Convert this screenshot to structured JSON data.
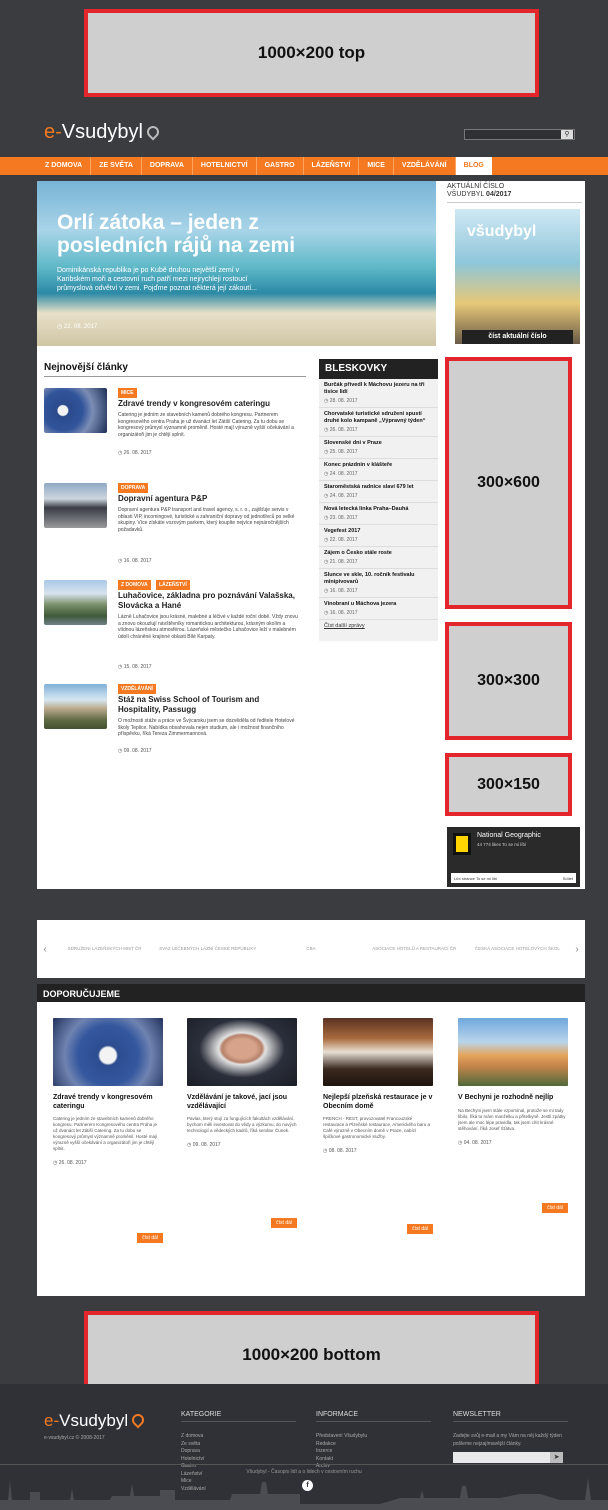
{
  "ads": {
    "top": "1000×200 top",
    "side1": "300×600",
    "side2": "300×300",
    "side3": "300×150",
    "bottom": "1000×200 bottom"
  },
  "header": {
    "logo_e": "e-",
    "logo_rest": "Vsudybyl",
    "search_placeholder": "",
    "search_icon": "search-icon"
  },
  "nav": [
    "Z DOMOVA",
    "ZE SVĚTA",
    "DOPRAVA",
    "HOTELNICTVÍ",
    "GASTRO",
    "LÁZEŇSTVÍ",
    "MICE",
    "VZDĚLÁVÁNÍ",
    "BLOG"
  ],
  "hero": {
    "title": "Orlí zátoka – jeden z posledních rájů na zemi",
    "text": "Dominikánská republika je po Kubě druhou největší zemí v Karibském moři a cestovní ruch patří mezi nejrychleji rostoucí průmyslová odvětví v zemi. Pojďme poznat některá její zákoutí...",
    "date": "22. 08. 2017"
  },
  "latest": {
    "heading": "Nejnovější články",
    "items": [
      {
        "tags": [
          "MICE"
        ],
        "title": "Zdravé trendy v kongresovém cateringu",
        "text": "Catering je jedním ze stavebních kamenů dobrého kongresu. Partnerem kongresového centra Praha je už dvanáct let Zátiší Catering. Za tu dobu se kongresový průmysl významně proměnil. Hosté mají výrazně vyšší očekávání a organizátoři jim je chtějí splnit.",
        "date": "26. 08. 2017"
      },
      {
        "tags": [
          "DOPRAVA"
        ],
        "title": "Dopravní agentura P&P",
        "text": "Dopravní agentura P&P transport and travel agency, s. r. o., zajišťuje servis v oblasti VIP, incomingové, turistické a zahraniční dopravy od jednotlivců po velké skupiny. Více získáte vozovým parkem, který koupíte nejvíce nejnáročnějších požadavků.",
        "date": "16. 08. 2017"
      },
      {
        "tags": [
          "Z DOMOVA",
          "LÁZEŇSTVÍ"
        ],
        "title": "Luhačovice, základna pro poznávání Valašska, Slovácka a Hané",
        "text": "Lázně Luhačovice jsou krásné, malebné a léčivé v každé roční době. Vždy znovu a znovu okouzlují návštěvníky romantickou architekturou, krásným okolím a vlídnou lázeňskou atmosférou. Lázeňské městečko Luhačovice leží v malebném údolí chráněné krajinné oblasti Bílé Karpaty.",
        "date": "15. 08. 2017"
      },
      {
        "tags": [
          "VZDĚLÁVÁNÍ"
        ],
        "title": "Stáž na Swiss School of Tourism and Hospitality, Passugg",
        "text": "O možnosti stáže a práce ve Švýcarsku jsem se dozvěděla od ředitele Hotelové školy Teplice. Nabídka obsahovala nejen studium, ale i možnost finančního příspěvku, říká Tereza Zimmermannová.",
        "date": "09. 08. 2017"
      }
    ]
  },
  "bleskovky": {
    "heading": "BLESKOVKY",
    "items": [
      {
        "title": "Burčák přivedl k Máchovu jezeru na tři tisíce lidí",
        "date": "28. 08. 2017"
      },
      {
        "title": "Chorvatské turistické sdružení spustí druhé kolo kampaně „Výpravný týden“",
        "date": "26. 08. 2017"
      },
      {
        "title": "Slovenské dni v Praze",
        "date": "25. 08. 2017"
      },
      {
        "title": "Konec prázdnin v klášteře",
        "date": "24. 08. 2017"
      },
      {
        "title": "Staroměstská radnice slaví 679 let",
        "date": "24. 08. 2017"
      },
      {
        "title": "Nová letecká linka Praha–Dauhá",
        "date": "23. 08. 2017"
      },
      {
        "title": "Vegefest 2017",
        "date": "22. 08. 2017"
      },
      {
        "title": "Zájem o Česko stále roste",
        "date": "21. 08. 2017"
      },
      {
        "title": "Slunce ve skle, 10. ročník festivalu minipivovarů",
        "date": "16. 08. 2017"
      },
      {
        "title": "Vinobraní u Máchova jezera",
        "date": "16. 08. 2017"
      }
    ],
    "more": "Číst další zprávy"
  },
  "sidebar": {
    "title1": "AKTUÁLNÍ ČÍSLO",
    "title2": "VŠUDYBYL ",
    "issue": "04/2017",
    "cover_brand": "všudybyl",
    "button": "číst aktuální číslo"
  },
  "ng": {
    "title": "National Geographic",
    "sub": "44 774 likes  To se mi líbí",
    "like": "Líbí stránce To se mi líbí",
    "share": "Sdílet"
  },
  "partners": [
    "SDRUŽENÍ LÁZEŇSKÝCH MIST ČR",
    "SVAZ LÉČEBNÝCH LÁZNÍ ČESKÉ REPUBLIKY",
    "CBA",
    "ASOCIACE HOTELŮ A RESTAURACÍ ČR",
    "ČESKÁ ASOCIACE HOTELOVÝCH ŠKOL"
  ],
  "recommend": {
    "heading": "DOPORUČUJEME",
    "cards": [
      {
        "title": "Zdravé trendy v kongresovém cateringu",
        "text": "Catering je jedním ze stavebních kamenů dobrého kongresu. Partnerem Kongresového centra Praha je už dvanáct let Zátiší Catering. Za tu dobu se kongresový průmysl významně proměnil. Hosté mají výrazně vyšší očekávání a organizátoři jim je chtějí splnit.",
        "date": "26. 08. 2017",
        "btn": "číst dál"
      },
      {
        "title": "Vzdělávání je takové, jací jsou vzdělávající",
        "text": "Pavlas, který stojí za fungujících fakultách vzdělávání, bychom měli investovat do vědy a výzkumu, do nových technologií a vědeckých kadrů, říká senátor Čunek.",
        "date": "09. 08. 2017",
        "btn": "číst dál"
      },
      {
        "title": "Nejlepší plzeňská restaurace je v Obecním domě",
        "text": "FRENCH - REST, provozovatel Francouzské restaurace a Plzeňské restaurace, Amerického baru a Café výrazně v Obecním domě v Praze, nabízí špičkové gastronomické služby.",
        "date": "08. 08. 2017",
        "btn": "číst dál"
      },
      {
        "title": "V Bechyni je rozhodně nejlíp",
        "text": "Na Bechyni jsem stále vzpomínal, protože se mi tady líbilo, říká tu mám manželku a přítelkyně. Jestli zpátky jsem ale moc lépe pravidla, tak jsem cítit krásné stěhování, říká Josef Šťátva.",
        "date": "04. 08. 2017",
        "btn": "číst dál"
      }
    ]
  },
  "footer": {
    "logo_e": "e-",
    "logo_rest": "Vsudybyl",
    "copy": "e-vsudybyl.cz © 2008-2017",
    "cat_h": "KATEGORIE",
    "cats": [
      "Z domova",
      "Ze světa",
      "Doprava",
      "Hotelnictví",
      "Gastro",
      "Lázeňství",
      "Mice",
      "Vzdělávání"
    ],
    "info_h": "INFORMACE",
    "infos": [
      "Představení Všudybylu",
      "Redakce",
      "Inzerce",
      "Kontakt",
      "Archiv"
    ],
    "news_h": "NEWSLETTER",
    "news_text": "Zadejte svůj e-mail a my Vám na něj každý týden pošleme nejzajímavější články.",
    "bottom": "Všudybyl - Časopis lidí a o lidech v cestovním ruchu",
    "fb": "f"
  }
}
